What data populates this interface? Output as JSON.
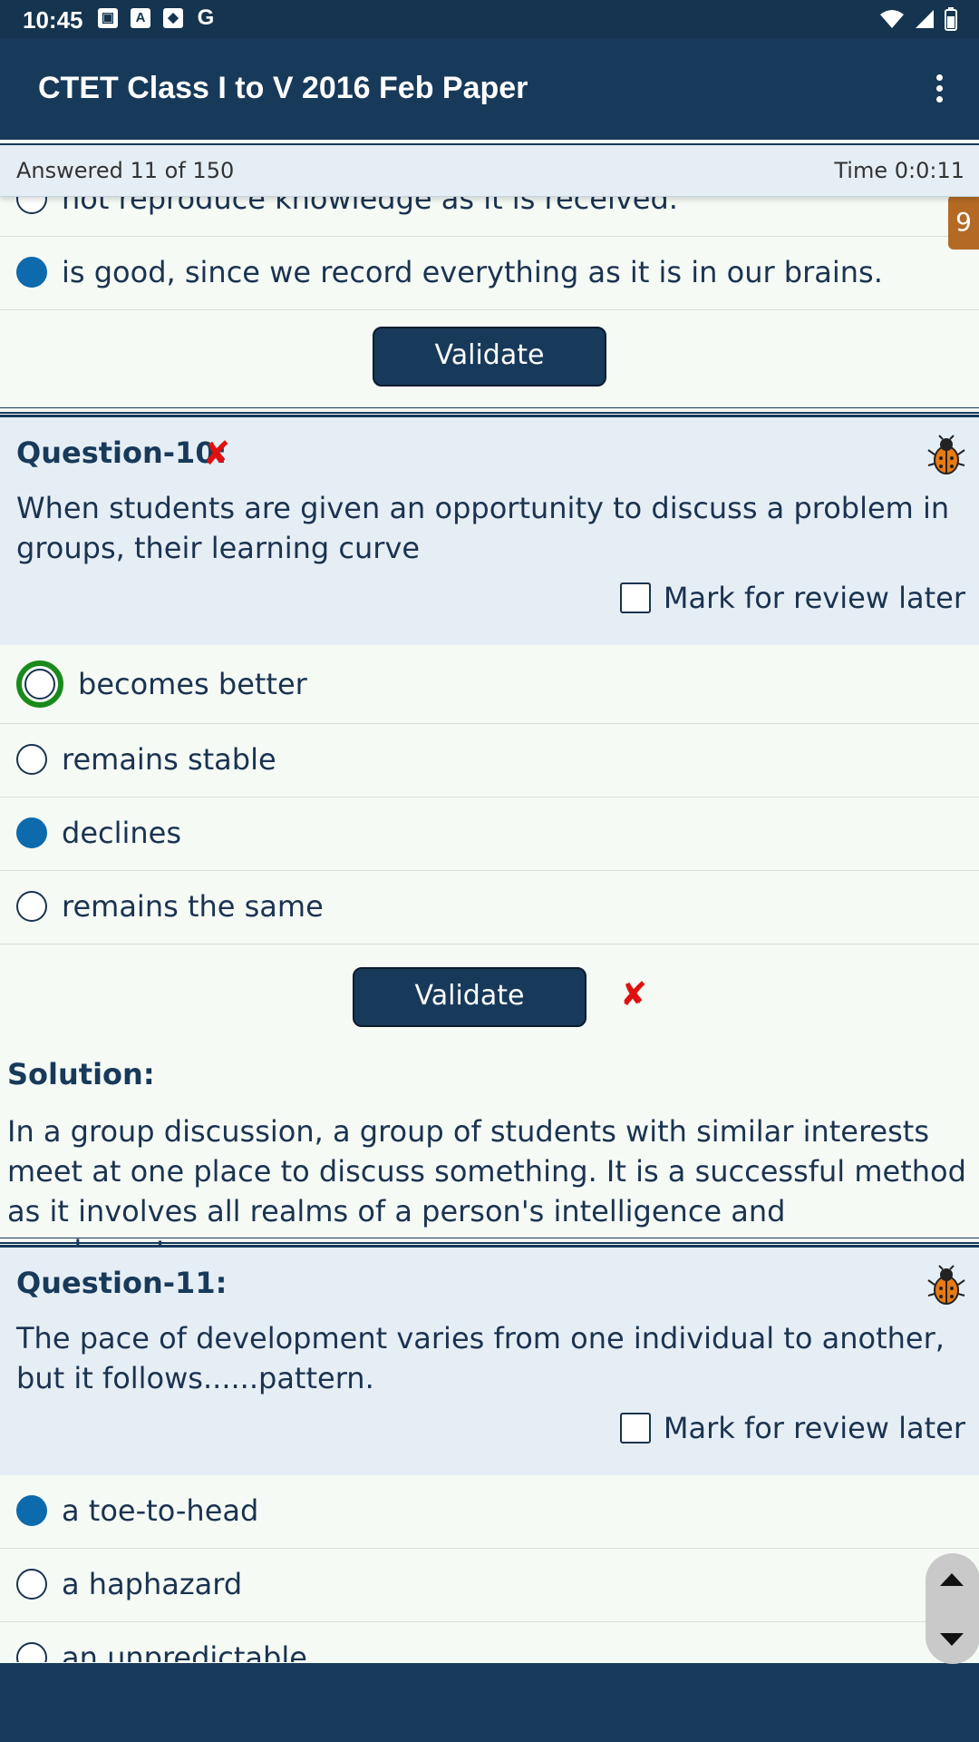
{
  "status_bar": {
    "time": "10:45",
    "icons": [
      "image-icon",
      "a-icon",
      "shield-icon",
      "g-icon"
    ],
    "right_icons": [
      "wifi-icon",
      "signal-icon",
      "battery-icon"
    ]
  },
  "app_bar": {
    "title": "CTET Class I to V 2016 Feb Paper",
    "menu_icon": "more-vert-icon"
  },
  "progress": {
    "answered": "Answered 11 of 150",
    "time": "Time 0:0:11"
  },
  "badge": {
    "number": "9"
  },
  "q9": {
    "options": [
      {
        "label": "not reproduce knowledge as it is received.",
        "selected": false
      },
      {
        "label": "is good, since we record everything as it is in our brains.",
        "selected": true
      }
    ],
    "validate_label": "Validate"
  },
  "q10": {
    "title": "Question-10:",
    "result": "✘",
    "text": "When students are given an opportunity to discuss a problem in groups, their learning curve",
    "mark_label": "Mark for review later",
    "options": [
      {
        "label": "becomes better",
        "state": "correct"
      },
      {
        "label": "remains stable",
        "state": "none"
      },
      {
        "label": "declines",
        "state": "selected"
      },
      {
        "label": "remains the same",
        "state": "none"
      }
    ],
    "validate_label": "Validate",
    "validate_result": "✘",
    "solution_title": "Solution:",
    "solution_text": "In a group discussion, a group of students with similar interests meet at one place to discuss something. It is a successful method as it involves all realms of a person's intelligence and psychomotor."
  },
  "q11": {
    "title": "Question-11:",
    "text": "The pace of development varies from one individual to another, but it follows......pattern.",
    "mark_label": "Mark for review later",
    "options": [
      {
        "label": "a toe-to-head",
        "state": "selected"
      },
      {
        "label": "a haphazard",
        "state": "none"
      },
      {
        "label": "an unpredictable",
        "state": "none"
      }
    ]
  },
  "colors": {
    "primary": "#183a5a",
    "selected": "#0d6aad",
    "correct": "#1a8a1a",
    "wrong": "#e01010",
    "badge": "#b46a24"
  }
}
